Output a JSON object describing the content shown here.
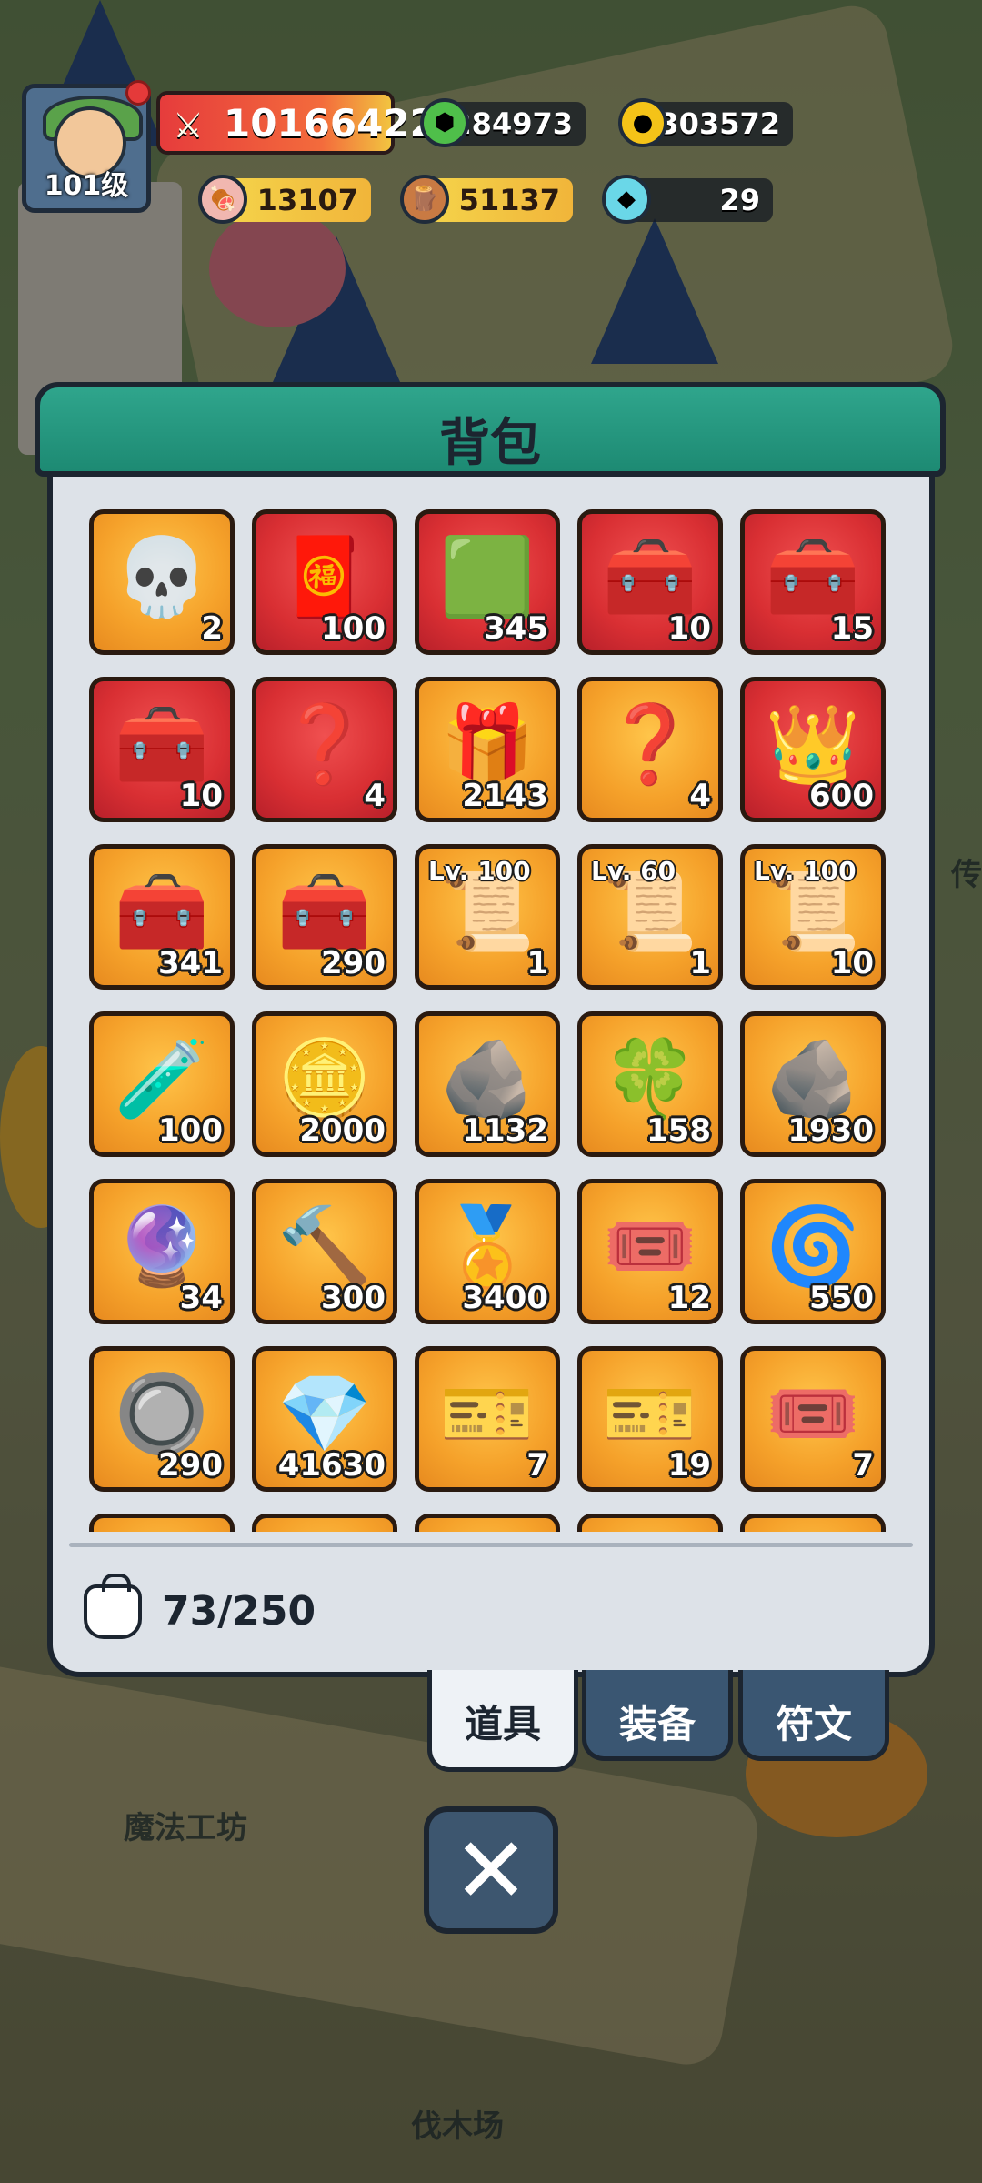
{
  "player": {
    "level_label": "101级"
  },
  "resources": {
    "power": "10166422",
    "gems": "284973",
    "gold": "303572",
    "meat": "13107",
    "wood": "51137",
    "crystal": "29"
  },
  "panel": {
    "title": "背包",
    "capacity": "73/250"
  },
  "items": [
    {
      "icon": "skull-icon",
      "glyph": "💀",
      "count": "2",
      "bg": "orange"
    },
    {
      "icon": "red-envelope-icon",
      "glyph": "🧧",
      "count": "100",
      "bg": "red"
    },
    {
      "icon": "green-card-icon",
      "glyph": "🟩",
      "count": "345",
      "bg": "red"
    },
    {
      "icon": "blue-chest-icon",
      "glyph": "🧰",
      "count": "10",
      "bg": "red"
    },
    {
      "icon": "blue-chest-icon",
      "glyph": "🧰",
      "count": "15",
      "bg": "red"
    },
    {
      "icon": "blue-chest-icon",
      "glyph": "🧰",
      "count": "10",
      "bg": "red"
    },
    {
      "icon": "mystery-chest-icon",
      "glyph": "❓",
      "count": "4",
      "bg": "red"
    },
    {
      "icon": "gem-chest-icon",
      "glyph": "🎁",
      "count": "2143",
      "bg": "orange"
    },
    {
      "icon": "mystery-chest-icon",
      "glyph": "❓",
      "count": "4",
      "bg": "orange"
    },
    {
      "icon": "royal-chest-icon",
      "glyph": "👑",
      "count": "600",
      "bg": "red"
    },
    {
      "icon": "blue-chest-icon",
      "glyph": "🧰",
      "count": "341",
      "bg": "orange"
    },
    {
      "icon": "blue-chest-icon",
      "glyph": "🧰",
      "count": "290",
      "bg": "orange"
    },
    {
      "icon": "scroll-icon",
      "glyph": "📜",
      "count": "1",
      "bg": "orange",
      "lv": "Lv. 100"
    },
    {
      "icon": "scroll-icon",
      "glyph": "📜",
      "count": "1",
      "bg": "orange",
      "lv": "Lv. 60"
    },
    {
      "icon": "scroll-icon",
      "glyph": "📜",
      "count": "10",
      "bg": "orange",
      "lv": "Lv. 100"
    },
    {
      "icon": "potion-icon",
      "glyph": "🧪",
      "count": "100",
      "bg": "orange"
    },
    {
      "icon": "coin-icon",
      "glyph": "🪙",
      "count": "2000",
      "bg": "orange"
    },
    {
      "icon": "pink-ore-icon",
      "glyph": "🪨",
      "count": "1132",
      "bg": "orange"
    },
    {
      "icon": "clover-icon",
      "glyph": "🍀",
      "count": "158",
      "bg": "orange"
    },
    {
      "icon": "stone-icon",
      "glyph": "🪨",
      "count": "1930",
      "bg": "orange"
    },
    {
      "icon": "purple-crystal-icon",
      "glyph": "🔮",
      "count": "34",
      "bg": "orange"
    },
    {
      "icon": "hammer-icon",
      "glyph": "🔨",
      "count": "300",
      "bg": "orange"
    },
    {
      "icon": "medal-icon",
      "glyph": "🏅",
      "count": "3400",
      "bg": "orange"
    },
    {
      "icon": "red-ticket-icon",
      "glyph": "🎟️",
      "count": "12",
      "bg": "orange"
    },
    {
      "icon": "rune-stone-icon",
      "glyph": "🌀",
      "count": "550",
      "bg": "orange"
    },
    {
      "icon": "white-rune-icon",
      "glyph": "🔘",
      "count": "290",
      "bg": "orange"
    },
    {
      "icon": "diamond-icon",
      "glyph": "💎",
      "count": "41630",
      "bg": "orange"
    },
    {
      "icon": "blue-ticket-icon",
      "glyph": "🎫",
      "count": "7",
      "bg": "orange"
    },
    {
      "icon": "blue-ticket-icon",
      "glyph": "🎫",
      "count": "19",
      "bg": "orange"
    },
    {
      "icon": "red-ticket-icon",
      "glyph": "🎟️",
      "count": "7",
      "bg": "orange"
    },
    {
      "icon": "partial-item",
      "glyph": "",
      "count": "",
      "bg": "orange"
    },
    {
      "icon": "partial-item",
      "glyph": "",
      "count": "",
      "bg": "orange"
    },
    {
      "icon": "partial-item",
      "glyph": "",
      "count": "",
      "bg": "orange"
    },
    {
      "icon": "partial-item",
      "glyph": "",
      "count": "",
      "bg": "orange"
    },
    {
      "icon": "partial-item",
      "glyph": "",
      "count": "",
      "bg": "orange"
    }
  ],
  "tabs": [
    {
      "label": "道具",
      "active": true
    },
    {
      "label": "装备",
      "active": false
    },
    {
      "label": "符文",
      "active": false
    }
  ],
  "close_glyph": "✕",
  "scene_labels": {
    "workshop": "魔法工坊",
    "lumber": "伐木场",
    "side": "传"
  }
}
